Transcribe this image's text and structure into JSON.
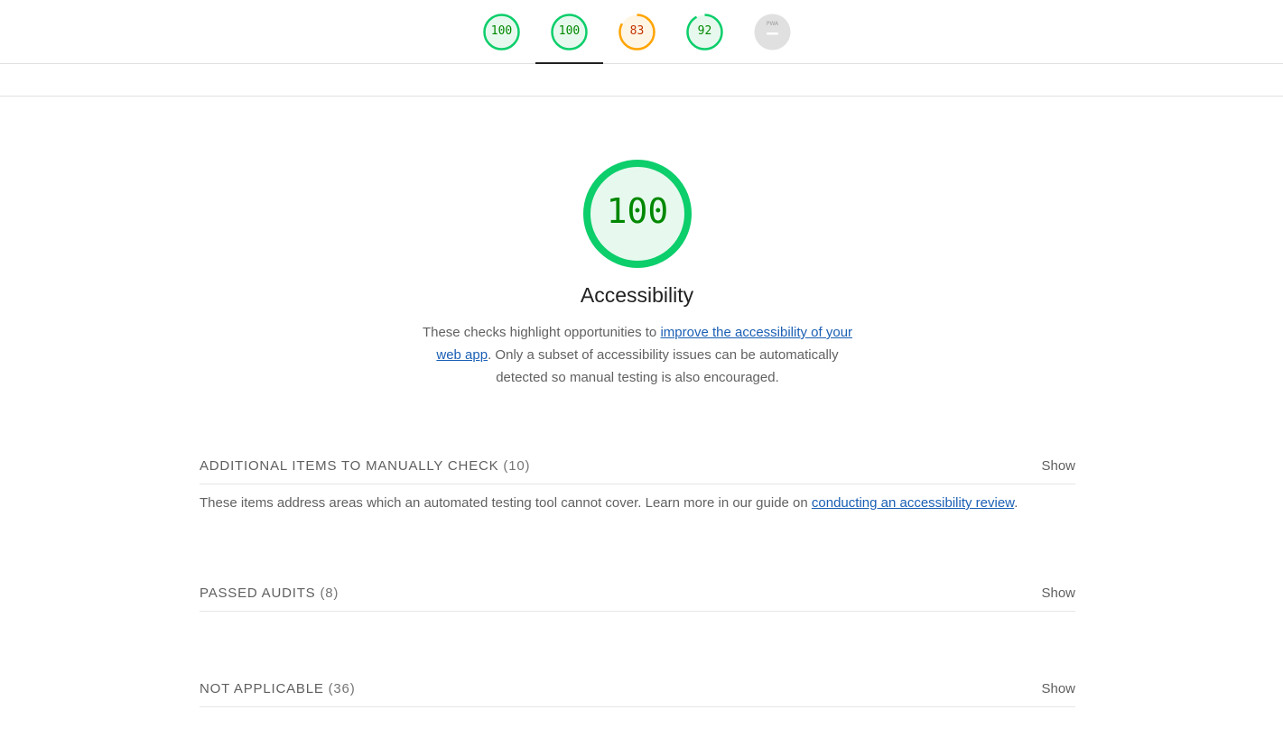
{
  "tabs": [
    {
      "score": "100",
      "color": "#0cce6b",
      "fill": "#e7f9ee",
      "text_color": "#008800",
      "fraction": 1.0
    },
    {
      "score": "100",
      "color": "#0cce6b",
      "fill": "#e7f9ee",
      "text_color": "#008800",
      "fraction": 1.0
    },
    {
      "score": "83",
      "color": "#ffa400",
      "fill": "#fff5e5",
      "text_color": "#c33300",
      "fraction": 0.83
    },
    {
      "score": "92",
      "color": "#0cce6b",
      "fill": "#e7f9ee",
      "text_color": "#008800",
      "fraction": 0.92
    },
    {
      "score": "",
      "icon": "pwa-badge-icon",
      "label": "PWA",
      "color": "#e0e0e0"
    }
  ],
  "active_tab_index": 1,
  "category": {
    "score": "100",
    "fraction": 1.0,
    "title": "Accessibility",
    "desc_before": "These checks highlight opportunities to ",
    "desc_link": "improve the accessibility of your web app",
    "desc_after": ". Only a subset of accessibility issues can be automatically detected so manual testing is also encouraged."
  },
  "groups": [
    {
      "title": "ADDITIONAL ITEMS TO MANUALLY CHECK",
      "count": "(10)",
      "show": "Show",
      "desc_before": "These items address areas which an automated testing tool cannot cover. Learn more in our guide on ",
      "desc_link": "conducting an accessibility review",
      "desc_after": "."
    },
    {
      "title": "PASSED AUDITS",
      "count": "(8)",
      "show": "Show"
    },
    {
      "title": "NOT APPLICABLE",
      "count": "(36)",
      "show": "Show"
    }
  ],
  "colors": {
    "pass": "#0cce6b",
    "average": "#ffa400",
    "pass_text": "#008800"
  }
}
